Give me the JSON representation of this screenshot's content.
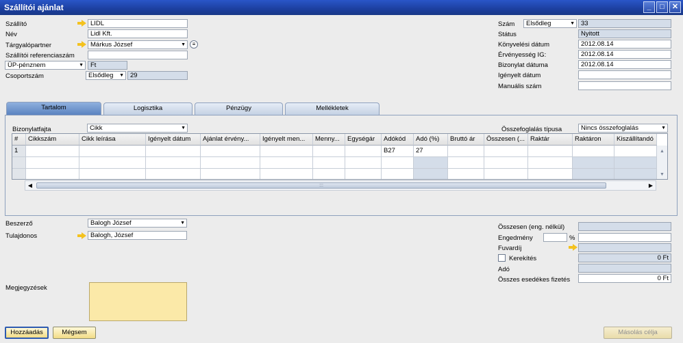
{
  "window": {
    "title": "Szállítói ajánlat"
  },
  "header_left": {
    "vendor_label": "Szállító",
    "vendor_value": "LIDL",
    "name_label": "Név",
    "name_value": "Lidl Kft.",
    "contact_label": "Tárgyalópartner",
    "contact_value": "Márkus József",
    "vendor_ref_label": "Szállítói referenciaszám",
    "vendor_ref_value": "",
    "currency_select": "ÜP-pénznem",
    "currency_value": "Ft",
    "group_label": "Csoportszám",
    "group_select": "Elsődleg",
    "group_value": "29"
  },
  "header_right": {
    "number_label": "Szám",
    "number_select": "Elsődleg",
    "number_value": "33",
    "status_label": "Státus",
    "status_value": "Nyitott",
    "posting_label": "Könyvelési dátum",
    "posting_value": "2012.08.14",
    "valid_label": "Érvényesség IG:",
    "valid_value": "2012.08.14",
    "docdate_label": "Bizonylat dátuma",
    "docdate_value": "2012.08.14",
    "reqdate_label": "Igényelt dátum",
    "reqdate_value": "",
    "manual_label": "Manuális szám",
    "manual_value": ""
  },
  "tabs": [
    "Tartalom",
    "Logisztika",
    "Pénzügy",
    "Mellékletek"
  ],
  "content": {
    "doctype_label": "Bizonylatfajta",
    "doctype_value": "Cikk",
    "summary_label": "Összefoglalás típusa",
    "summary_value": "Nincs összefoglalás",
    "columns": [
      "#",
      "Cikkszám",
      "Cikk leírása",
      "Igényelt dátum",
      "Ajánlat érvény...",
      "Igényelt men...",
      "Menny...",
      "Egységár",
      "Adókód",
      "Adó (%)",
      "Bruttó ár",
      "Összesen (...",
      "Raktár",
      "Raktáron",
      "Kiszállítandó"
    ],
    "rows": [
      [
        "1",
        "",
        "",
        "",
        "",
        "",
        "",
        "",
        "B27",
        "27",
        "",
        "",
        "",
        "",
        ""
      ],
      [
        "",
        "",
        "",
        "",
        "",
        "",
        "",
        "",
        "",
        "",
        "",
        "",
        "",
        "",
        ""
      ],
      [
        "",
        "",
        "",
        "",
        "",
        "",
        "",
        "",
        "",
        "",
        "",
        "",
        "",
        "",
        ""
      ]
    ]
  },
  "footer_left": {
    "buyer_label": "Beszerző",
    "buyer_value": "Balogh József",
    "owner_label": "Tulajdonos",
    "owner_value": "Balogh, József",
    "remarks_label": "Megjegyzések"
  },
  "footer_right": {
    "total_before_label": "Összesen (eng. nélkül)",
    "total_before_value": "",
    "discount_label": "Engedmény",
    "discount_value": "",
    "percent_sign": "%",
    "discount_amount": "",
    "freight_label": "Fuvardíj",
    "freight_value": "",
    "rounding_label": "Kerekítés",
    "rounding_value": "0 Ft",
    "tax_label": "Adó",
    "tax_value": "",
    "total_due_label": "Összes esedékes fizetés",
    "total_due_value": "0 Ft"
  },
  "buttons": {
    "add": "Hozzáadás",
    "cancel": "Mégsem",
    "copy_to": "Másolás célja"
  },
  "colors": {
    "title_bar": "#1c3f9f",
    "readonly_field": "#d4dde9",
    "memo": "#fbe9a8",
    "button": "#f2dc86",
    "link_arrow": "#f4c21e"
  }
}
